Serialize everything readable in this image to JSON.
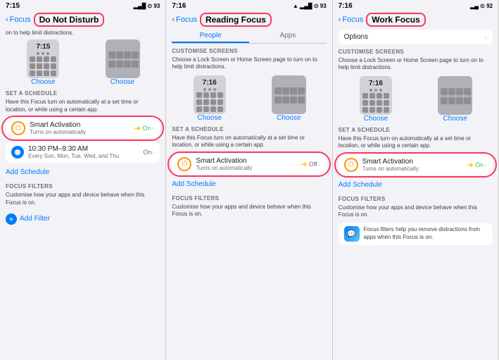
{
  "panels": [
    {
      "id": "do-not-disturb",
      "status_time": "7:15",
      "status_icons": "▂▄█ ⊙ 93",
      "nav_back": "Focus",
      "nav_title": "Do Not Disturb",
      "truncated_desc": "on to help limit distractions.",
      "screen1_time": "7:15",
      "screen2_placeholder": "",
      "choose1": "Choose",
      "choose2": "Choose",
      "section_schedule": "SET A SCHEDULE",
      "schedule_desc": "Have this Focus turn on automatically at a set time or location, or while using a certain app.",
      "smart_activation_label": "Smart Activation",
      "smart_activation_sub": "Turns on automatically",
      "smart_activation_state": "On",
      "time_row_main": "10:30 PM–9:30 AM",
      "time_row_sub": "Every Sun, Mon, Tue, Wed, and Thu",
      "time_row_state": "On",
      "add_schedule": "Add Schedule",
      "section_filters": "FOCUS FILTERS",
      "filters_desc": "Customise how your apps and device behave when this Focus is on.",
      "add_filter": "Add Filter"
    },
    {
      "id": "reading-focus",
      "status_time": "7:16",
      "status_icons": "▂▄█ ⊙ 93",
      "nav_back": "Focus",
      "nav_title": "Reading Focus",
      "tab_people": "People",
      "tab_apps": "Apps",
      "section_screens": "CUSTOMISE SCREENS",
      "screens_desc": "Choose a Lock Screen or Home Screen page to turn on to help limit distractions.",
      "screen1_time": "7:16",
      "choose1": "Choose",
      "choose2": "Choose",
      "section_schedule": "SET A SCHEDULE",
      "schedule_desc": "Have this Focus turn on automatically at a set time or location, or while using a certain app.",
      "smart_activation_label": "Smart Activation",
      "smart_activation_sub": "Turns on automatically",
      "smart_activation_state": "Off",
      "add_schedule": "Add Schedule",
      "section_filters": "FOCUS FILTERS",
      "filters_desc": "Customise how your apps and device behave when this Focus is on."
    },
    {
      "id": "work-focus",
      "status_time": "7:16",
      "status_icons": "▂▄ ⊙ 92",
      "nav_back": "Focus",
      "nav_title": "Work Focus",
      "options_label": "Options",
      "section_screens": "CUSTOMISE SCREENS",
      "screens_desc": "Choose a Lock Screen or Home Screen page to turn on to help limit distractions.",
      "screen1_time": "7:16",
      "choose1": "Choose",
      "choose2": "Choose",
      "section_schedule": "SET A SCHEDULE",
      "schedule_desc": "Have this Focus turn on automatically at a set time or location, or while using a certain app.",
      "smart_activation_label": "Smart Activation",
      "smart_activation_sub": "Turns on automatically",
      "smart_activation_state": "On",
      "add_schedule": "Add Schedule",
      "section_filters": "FOCUS FILTERS",
      "filters_desc": "Customise how your apps and device behave when this Focus is on.",
      "filter_desc_text": "Focus filters help you remove distractions from apps when this Focus is on."
    }
  ]
}
